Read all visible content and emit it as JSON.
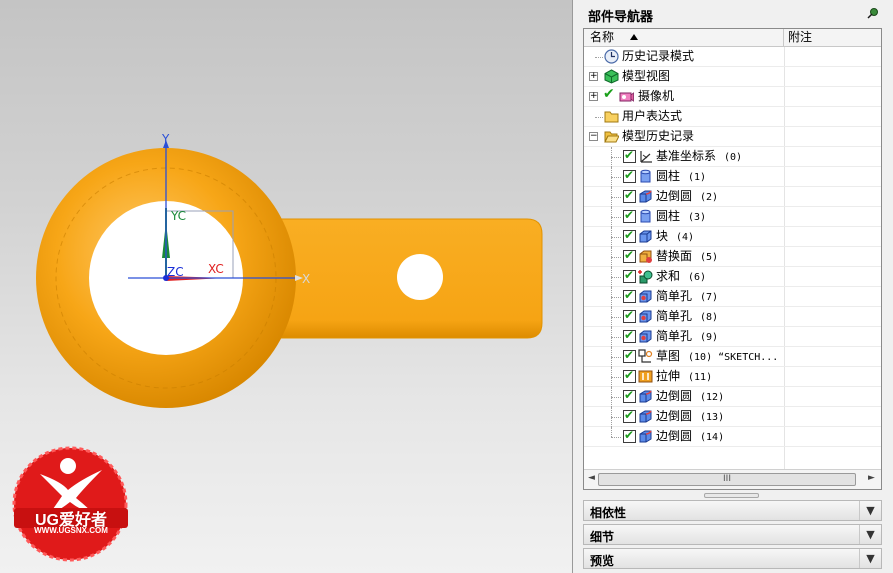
{
  "viewport": {
    "axes": {
      "y_label": "Y",
      "x_label": "X",
      "yc_label": "YC",
      "xc_label": "XC",
      "zc_label": "ZC"
    },
    "colors": {
      "part": "#f7a617",
      "part_shadow": "#d98800",
      "hole": "#ffffff",
      "axis_blue": "#2a4fd8",
      "axis_red": "#e02020",
      "axis_green": "#1a8a3a",
      "background_top": "#c4c4c4"
    },
    "watermark": {
      "brand": "UG爱好者",
      "url": "WWW.UGSNX.COM",
      "color": "#e01a1a"
    }
  },
  "navigator": {
    "title": "部件导航器",
    "pin_icon": "pin-icon",
    "columns": {
      "name": "名称",
      "note": "附注"
    },
    "nodes": [
      {
        "label": "历史记录模式",
        "icon": "clock-icon",
        "indent": 0,
        "expander": ""
      },
      {
        "label": "模型视图",
        "icon": "model-views-icon",
        "indent": 0,
        "expander": "+"
      },
      {
        "label": "摄像机",
        "icon": "camera-icon",
        "indent": 0,
        "expander": "+",
        "checked": true
      },
      {
        "label": "用户表达式",
        "icon": "folder-icon",
        "indent": 0,
        "expander": ""
      },
      {
        "label": "模型历史记录",
        "icon": "folder-open-icon",
        "indent": 0,
        "expander": "-"
      }
    ],
    "features": [
      {
        "label": "基准坐标系",
        "num": "(0)",
        "icon": "datum-csys-icon"
      },
      {
        "label": "圆柱",
        "num": "(1)",
        "icon": "cylinder-icon"
      },
      {
        "label": "边倒圆",
        "num": "(2)",
        "icon": "edge-blend-icon"
      },
      {
        "label": "圆柱",
        "num": "(3)",
        "icon": "cylinder-icon"
      },
      {
        "label": "块",
        "num": "(4)",
        "icon": "block-icon"
      },
      {
        "label": "替换面",
        "num": "(5)",
        "icon": "replace-face-icon"
      },
      {
        "label": "求和",
        "num": "(6)",
        "icon": "unite-icon"
      },
      {
        "label": "简单孔",
        "num": "(7)",
        "icon": "simple-hole-icon"
      },
      {
        "label": "简单孔",
        "num": "(8)",
        "icon": "simple-hole-icon"
      },
      {
        "label": "简单孔",
        "num": "(9)",
        "icon": "simple-hole-icon"
      },
      {
        "label": "草图",
        "num": "(10) “SKETCH...",
        "icon": "sketch-icon"
      },
      {
        "label": "拉伸",
        "num": "(11)",
        "icon": "extrude-icon"
      },
      {
        "label": "边倒圆",
        "num": "(12)",
        "icon": "edge-blend-icon"
      },
      {
        "label": "边倒圆",
        "num": "(13)",
        "icon": "edge-blend-icon"
      },
      {
        "label": "边倒圆",
        "num": "(14)",
        "icon": "edge-blend-icon"
      }
    ],
    "scrollbar": {
      "left": "◄",
      "thumb": "III",
      "right": "►"
    }
  },
  "sections": [
    {
      "label": "相依性",
      "icon": "chevron-down-icon"
    },
    {
      "label": "细节",
      "icon": "chevron-down-icon"
    },
    {
      "label": "预览",
      "icon": "chevron-down-icon"
    }
  ]
}
